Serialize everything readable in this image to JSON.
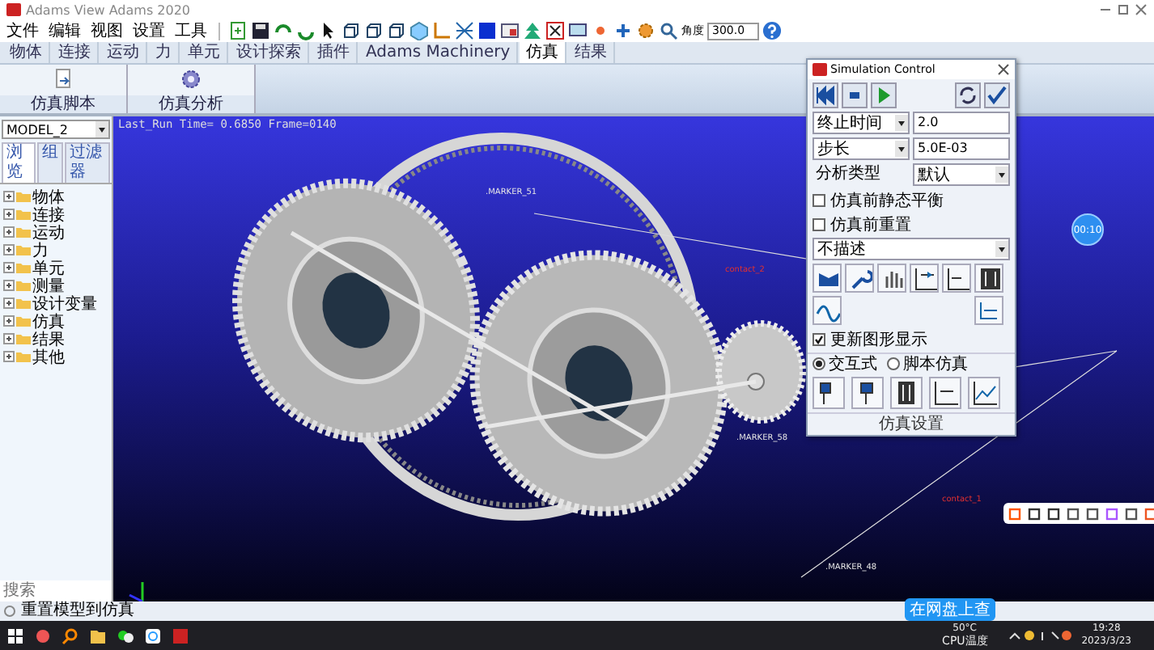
{
  "window": {
    "title": "Adams View Adams 2020"
  },
  "menu": [
    "文件",
    "编辑",
    "视图",
    "设置",
    "工具"
  ],
  "toolbar": {
    "angle_label": "角度",
    "angle_value": "300.0"
  },
  "tabs": [
    {
      "label": "物体",
      "selected": false
    },
    {
      "label": "连接",
      "selected": false
    },
    {
      "label": "运动",
      "selected": false
    },
    {
      "label": "力",
      "selected": false
    },
    {
      "label": "单元",
      "selected": false
    },
    {
      "label": "设计探索",
      "selected": false
    },
    {
      "label": "插件",
      "selected": false
    },
    {
      "label": "Adams Machinery",
      "selected": false
    },
    {
      "label": "仿真",
      "selected": true
    },
    {
      "label": "结果",
      "selected": false
    }
  ],
  "ribbon": [
    {
      "label": "仿真脚本",
      "kind": "script"
    },
    {
      "label": "仿真分析",
      "kind": "analysis"
    }
  ],
  "browser": {
    "model": "MODEL_2",
    "tabs": [
      {
        "label": "浏览",
        "selected": true
      },
      {
        "label": "组",
        "selected": false
      },
      {
        "label": "过滤器",
        "selected": false
      }
    ],
    "tree": [
      {
        "label": "物体",
        "expanded": false
      },
      {
        "label": "连接",
        "expanded": false
      },
      {
        "label": "运动",
        "expanded": false
      },
      {
        "label": "力",
        "expanded": false
      },
      {
        "label": "单元",
        "expanded": false
      },
      {
        "label": "测量",
        "expanded": false
      },
      {
        "label": "设计变量",
        "expanded": false
      },
      {
        "label": "仿真",
        "expanded": false
      },
      {
        "label": "结果",
        "expanded": false
      },
      {
        "label": "其他",
        "expanded": false
      }
    ],
    "search": {
      "placeholder": "搜索"
    }
  },
  "viewport": {
    "info": "Last_Run   Time= 0.6850   Frame=0140",
    "timer": "00:10",
    "markers": [
      {
        "label": ".MARKER_51",
        "kind": "marker"
      },
      {
        "label": "contact_2",
        "kind": "contact"
      },
      {
        "label": ".MARKER_58",
        "kind": "marker"
      },
      {
        "label": "contact_1",
        "kind": "contact"
      },
      {
        "label": ".MARKER_48",
        "kind": "marker"
      }
    ]
  },
  "sim_control": {
    "title": "Simulation Control",
    "fields": [
      {
        "label": "终止时间",
        "value": "2.0"
      },
      {
        "label": "步长",
        "value": "5.0E-03"
      }
    ],
    "analysis_label": "分析类型",
    "analysis_value": "默认",
    "options": [
      {
        "label": "仿真前静态平衡",
        "checked": false
      },
      {
        "label": "仿真前重置",
        "checked": false
      }
    ],
    "script_value": "不描述",
    "update_graphics": {
      "label": "更新图形显示",
      "checked": true
    },
    "modes": [
      {
        "label": "交互式",
        "selected": true
      },
      {
        "label": "脚本仿真",
        "selected": false
      }
    ],
    "footer": "仿真设置"
  },
  "status_bar": {
    "message": "重置模型到仿真"
  },
  "cloud_badge": "在网盘上查",
  "taskbar": {
    "temperature": "50°C",
    "temperature_label": "CPU温度",
    "time": "19:28",
    "date": "2023/3/23"
  }
}
